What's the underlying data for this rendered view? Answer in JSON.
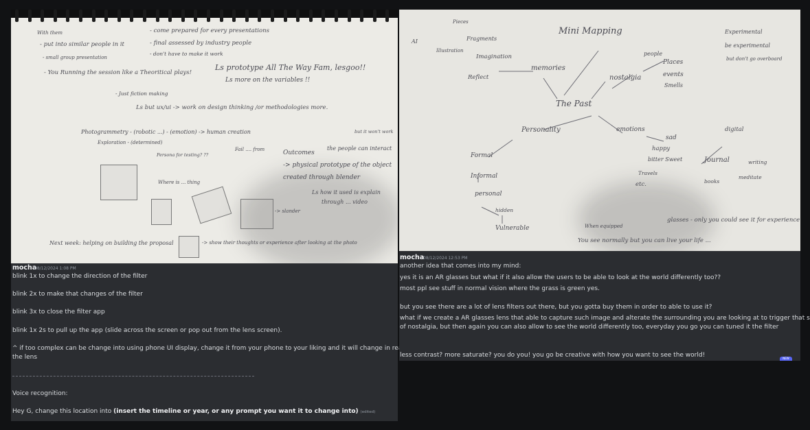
{
  "left_photo": {
    "lines": [
      "With them",
      "- put into similar people in it",
      "- small group presentation",
      "- You Running the session like a Theoritical plays!",
      "- come prepared for every presentations",
      "- final assessed by industry people",
      "- don't have to make it work",
      "Ls prototype All The Way Fam, lesgoo!!",
      "Ls more on the variables !!",
      "- Just fiction making",
      "Ls but ux/ui -> work on design thinking /or methodologies more.",
      "Photogrammetry - (robotic ...) - (emotion) -> human creation",
      "Exploration - (determined)",
      "Fail .... from",
      "Outcomes",
      "the people can interact",
      "-> physical prototype of the object",
      "created through blender",
      "Ls how it used is explain",
      "through ... video",
      "but it won't work",
      "Persona for testing? ??",
      "Where is ... thing",
      "-> slander",
      "Next week: helping on building the proposal",
      "-> show their thoughts or experience after looking at the photo"
    ]
  },
  "right_photo": {
    "lines": [
      "Mini Mapping",
      "Pieces",
      "Fragments",
      "AI",
      "Illustration",
      "Imagination",
      "Reflect",
      "memories",
      "people",
      "Places",
      "events",
      "Smells",
      "nostalgia",
      "The Past",
      "Experimental",
      "be experimental",
      "but don't go overboard",
      "Personality",
      "emotions",
      "digital",
      "Formal",
      "Informal",
      "personal",
      "hidden",
      "Vulnerable",
      "sad",
      "happy",
      "bitter Sweet",
      "Travels",
      "etc.",
      "Journal",
      "writing",
      "books",
      "meditate",
      "glasses - only you could see it for experience it",
      "When equipped",
      "You see normally but you can live your life ..."
    ]
  },
  "left_message": {
    "author": "mocha",
    "timestamp": "08/12/2024 1:08 PM",
    "lines": [
      "blink 1x to change the direction of the filter",
      "blink 2x to make that changes of the filter",
      "blink 3x to close the filter app",
      "blink 1x 2s to pull up the app (slide across the screen or pop out from the lens screen).",
      "^ if too complex can be change into using phone UI display, change it from your phone to your liking and it will change in real time with",
      "the lens",
      "Voice recognition:",
      "Hey G, change this location into "
    ],
    "bold_text": "(insert the timeline or year, or any prompt you want it to change into)",
    "edited_label": "(edited)"
  },
  "right_message": {
    "author": "mocha",
    "timestamp": "08/12/2024 12:53 PM",
    "lines": [
      "another idea that comes into my mind:",
      "yes it is an AR glasses but what if it also allow the users to be able to look at the world differently too??",
      "most ppl see stuff in normal vision where the grass is green yes.",
      "but you see there are a lot of lens filters out there, but you gotta buy them in order to able to use it?",
      "what if we create a AR glasses lens that able to capture such image and alterate the surrounding you are looking at to trigger that sense",
      "of nostalgia, but then again you can also allow to see the world differently too, everyday you go you can tuned it the filter",
      "less contrast? more saturate? you do you! you go be creative with how you want to see the world!"
    ],
    "badge": "NEW"
  },
  "colors": {
    "background": "#111214",
    "panel": "#2b2d31",
    "text": "#dbdee1",
    "muted": "#949ba4",
    "badge": "#5865f2"
  }
}
